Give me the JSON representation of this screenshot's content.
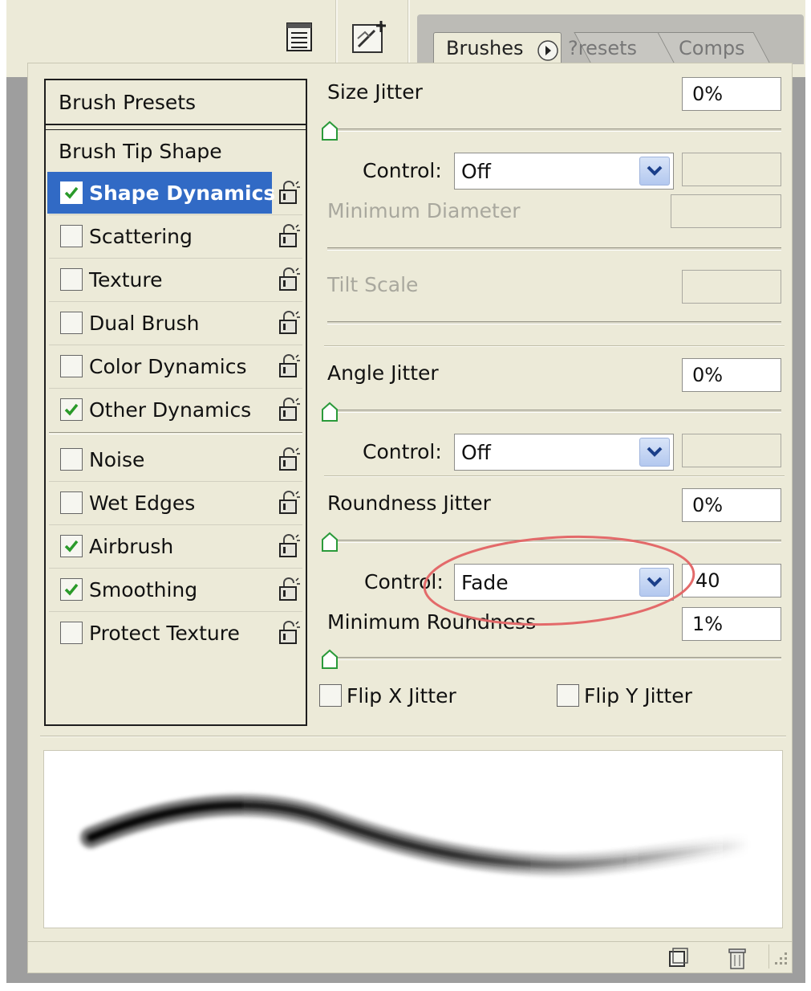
{
  "toolbar": {
    "palette_menu_icon": "palette-menu-icon",
    "new_preset_icon": "brush-preset-icon"
  },
  "tabs": [
    {
      "label": "Brushes",
      "active": true
    },
    {
      "label": "?resets",
      "active": false
    },
    {
      "label": "Comps",
      "active": false
    }
  ],
  "left_list": {
    "brush_presets": "Brush Presets",
    "brush_tip_shape": "Brush Tip Shape",
    "items": [
      {
        "label": "Shape Dynamics",
        "checked": true,
        "selected": true
      },
      {
        "label": "Scattering",
        "checked": false
      },
      {
        "label": "Texture",
        "checked": false
      },
      {
        "label": "Dual Brush",
        "checked": false
      },
      {
        "label": "Color Dynamics",
        "checked": false
      },
      {
        "label": "Other Dynamics",
        "checked": true
      },
      {
        "label": "Noise",
        "checked": false
      },
      {
        "label": "Wet Edges",
        "checked": false
      },
      {
        "label": "Airbrush",
        "checked": true
      },
      {
        "label": "Smoothing",
        "checked": true
      },
      {
        "label": "Protect Texture",
        "checked": false
      }
    ]
  },
  "size_jitter": {
    "label": "Size Jitter",
    "value": "0%",
    "slider": 0
  },
  "size_control": {
    "label": "Control:",
    "value": "Off",
    "extra": ""
  },
  "min_diameter": {
    "label": "Minimum Diameter",
    "value": "",
    "slider": 0
  },
  "tilt_scale": {
    "label": "Tilt Scale",
    "value": "",
    "slider": 0
  },
  "angle_jitter": {
    "label": "Angle Jitter",
    "value": "0%",
    "slider": 0
  },
  "angle_control": {
    "label": "Control:",
    "value": "Off",
    "extra": ""
  },
  "roundness_jitter": {
    "label": "Roundness Jitter",
    "value": "0%",
    "slider": 0
  },
  "roundness_control": {
    "label": "Control:",
    "value": "Fade",
    "extra": "40"
  },
  "min_roundness": {
    "label": "Minimum Roundness",
    "value": "1%",
    "slider": 0.01
  },
  "flip_x": {
    "label": "Flip X Jitter",
    "checked": false
  },
  "flip_y": {
    "label": "Flip Y Jitter",
    "checked": false
  },
  "bottom": {
    "new_brush_icon": "new-brush-icon",
    "trash_icon": "trash-icon",
    "resize_icon": "resize-grip-icon"
  },
  "colors": {
    "panel_bg": "#ecead8",
    "selection": "#316ac5",
    "highlight_ellipse": "#e36a6a",
    "check": "#2a9a2a"
  }
}
